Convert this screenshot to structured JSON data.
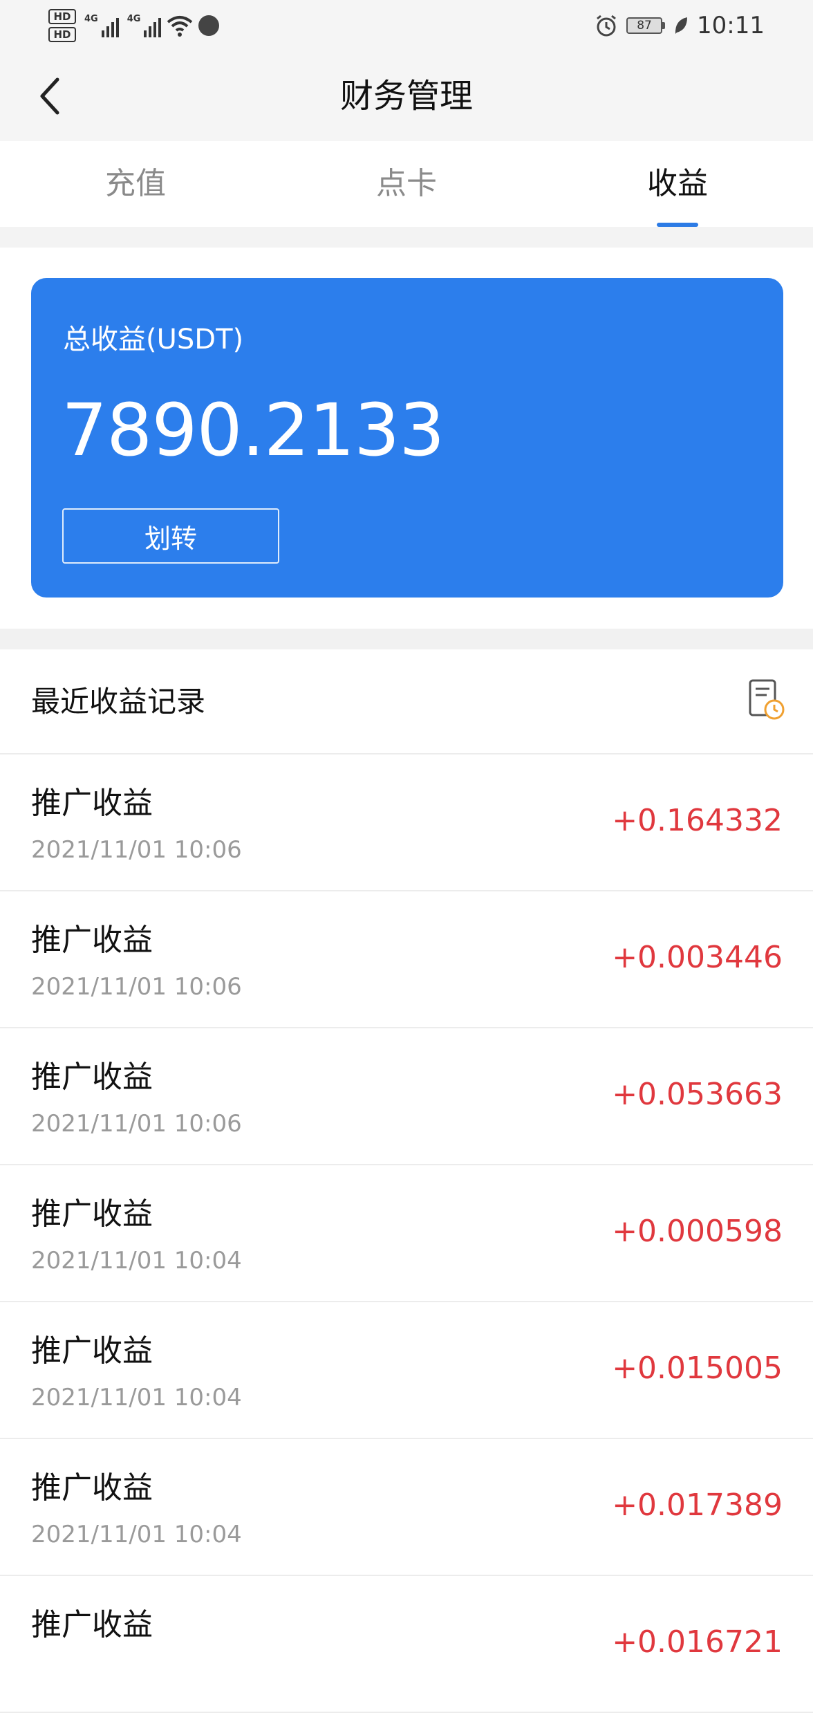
{
  "status_bar": {
    "hd1": "HD",
    "hd2": "HD",
    "net1": "4G",
    "net2": "4G",
    "battery": "87",
    "time": "10:11"
  },
  "header": {
    "title": "财务管理",
    "back_icon": "chevron-left-icon"
  },
  "tabs": [
    {
      "label": "充值",
      "active": false
    },
    {
      "label": "点卡",
      "active": false
    },
    {
      "label": "收益",
      "active": true
    }
  ],
  "card": {
    "label": "总收益(USDT)",
    "value": "7890.2133",
    "button_label": "划转",
    "color": "#2c7eec"
  },
  "records": {
    "title": "最近收益记录",
    "icon": "record-history-icon",
    "items": [
      {
        "title": "推广收益",
        "time": "2021/11/01 10:06",
        "amount": "+0.164332"
      },
      {
        "title": "推广收益",
        "time": "2021/11/01 10:06",
        "amount": "+0.003446"
      },
      {
        "title": "推广收益",
        "time": "2021/11/01 10:06",
        "amount": "+0.053663"
      },
      {
        "title": "推广收益",
        "time": "2021/11/01 10:04",
        "amount": "+0.000598"
      },
      {
        "title": "推广收益",
        "time": "2021/11/01 10:04",
        "amount": "+0.015005"
      },
      {
        "title": "推广收益",
        "time": "2021/11/01 10:04",
        "amount": "+0.017389"
      },
      {
        "title": "推广收益",
        "time": "",
        "amount": "+0.016721"
      }
    ]
  },
  "colors": {
    "accent": "#2c7be5",
    "amount": "#e0383e"
  }
}
